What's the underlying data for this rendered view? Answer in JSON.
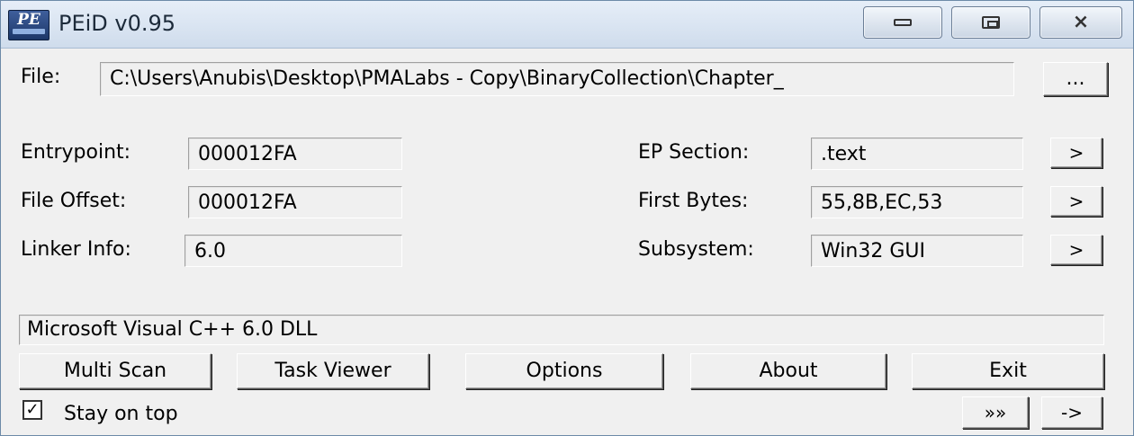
{
  "window": {
    "title": "PEiD v0.95",
    "icon_text": "PE",
    "controls": [
      "minimize-icon",
      "maximize-icon",
      "close-icon"
    ]
  },
  "file": {
    "label": "File:",
    "path": "C:\\Users\\Anubis\\Desktop\\PMALabs - Copy\\BinaryCollection\\Chapter_",
    "browse_label": "..."
  },
  "info": {
    "entrypoint_label": "Entrypoint:",
    "entrypoint_value": "000012FA",
    "file_offset_label": "File Offset:",
    "file_offset_value": "000012FA",
    "linker_info_label": "Linker Info:",
    "linker_info_value": "6.0",
    "ep_section_label": "EP Section:",
    "ep_section_value": ".text",
    "first_bytes_label": "First Bytes:",
    "first_bytes_value": "55,8B,EC,53",
    "subsystem_label": "Subsystem:",
    "subsystem_value": "Win32 GUI",
    "detail_button_label": ">"
  },
  "result": "Microsoft Visual C++ 6.0 DLL",
  "buttons": {
    "multi_scan": "Multi Scan",
    "task_viewer": "Task Viewer",
    "options": "Options",
    "about": "About",
    "exit": "Exit",
    "plugins": "»»",
    "arrow": "->"
  },
  "stay_on_top": {
    "label": "Stay on top",
    "checked": true,
    "mark": "✓"
  }
}
